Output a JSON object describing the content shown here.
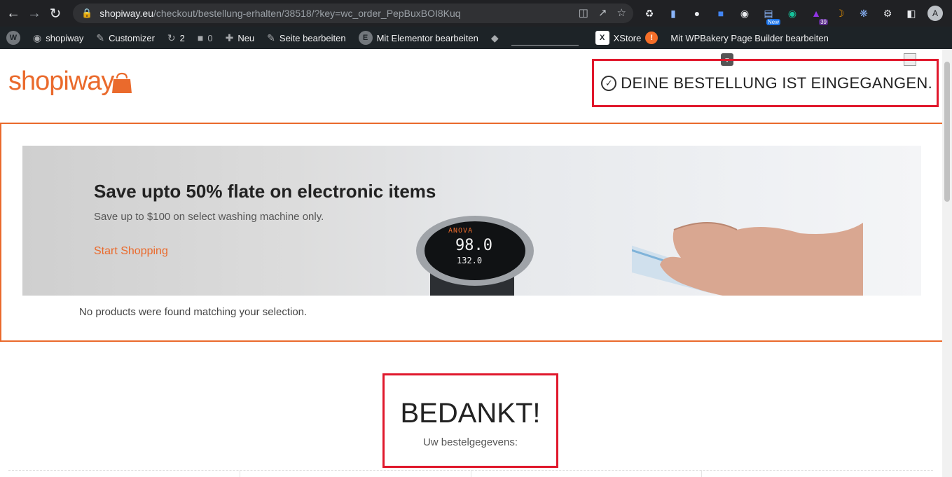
{
  "browser": {
    "url_host": "shopiway.eu",
    "url_path": "/checkout/bestellung-erhalten/38518/?key=wc_order_PepBuxBOI8Kuq",
    "extensions": [
      {
        "name": "translate-icon",
        "badge": ""
      },
      {
        "name": "share-icon",
        "badge": ""
      },
      {
        "name": "star-icon",
        "badge": ""
      },
      {
        "name": "recycle-icon",
        "badge": ""
      },
      {
        "name": "document-icon",
        "badge": ""
      },
      {
        "name": "globe-icon",
        "badge": ""
      },
      {
        "name": "google-translate-icon",
        "badge": ""
      },
      {
        "name": "camera-icon",
        "badge": ""
      },
      {
        "name": "new-extension-icon",
        "badge": "New"
      },
      {
        "name": "grammarly-icon",
        "badge": ""
      },
      {
        "name": "graduation-icon",
        "badge": "39"
      },
      {
        "name": "moon-icon",
        "badge": ""
      },
      {
        "name": "spiral-icon",
        "badge": ""
      },
      {
        "name": "puzzle-icon",
        "badge": ""
      },
      {
        "name": "sidebar-icon",
        "badge": ""
      }
    ],
    "avatar_letter": "A"
  },
  "wp_admin_bar": {
    "site_name": "shopiway",
    "customizer": "Customizer",
    "updates_count": "2",
    "comments_count": "0",
    "new_label": "Neu",
    "edit_page": "Seite bearbeiten",
    "elementor": "Mit Elementor bearbeiten",
    "xstore": "XStore",
    "xstore_alert": "!",
    "wpbakery": "Mit WPBakery Page Builder bearbeiten"
  },
  "header": {
    "logo_text": "shopiway",
    "order_received": "DEINE BESTELLUNG IST EINGEGANGEN."
  },
  "promo": {
    "title": "Save upto 50% flate on electronic items",
    "subtitle": "Save up to $100 on select washing machine only.",
    "link": "Start Shopping",
    "device_brand": "ANOVA",
    "device_temp": "98.0",
    "device_temp2": "132.0",
    "no_products": "No products were found matching your selection."
  },
  "thanks": {
    "title": "BEDANKT!",
    "subtitle": "Uw bestelgegevens:"
  },
  "colors": {
    "brand": "#ea6a2c",
    "highlight": "#e0182c"
  }
}
